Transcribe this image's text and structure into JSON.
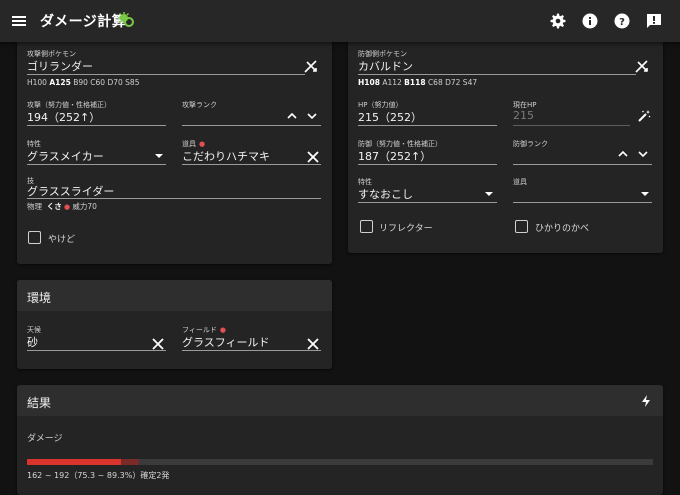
{
  "appbar": {
    "title": "ダメージ計算",
    "icons": [
      "menu-icon",
      "logo-icon",
      "settings-icon",
      "info-icon",
      "help-icon",
      "feedback-icon"
    ]
  },
  "attacker": {
    "pokemon_label": "攻撃側ポケモン",
    "pokemon_value": "ゴリランダー",
    "stats": {
      "h": "H100",
      "a": "A125",
      "rest": "B90 C60 D70 S85"
    },
    "attack_label": "攻撃（努力値・性格補正）",
    "attack_value": "194（252↑）",
    "rank_label": "攻撃ランク",
    "rank_value": "",
    "ability_label": "特性",
    "ability_value": "グラスメイカー",
    "item_label": "道具",
    "item_value": "こだわりハチマキ",
    "move_label": "技",
    "move_value": "グラススライダー",
    "move_category": "物理",
    "move_type": "くさ",
    "move_power": "威力70",
    "burn_label": "やけど"
  },
  "defender": {
    "pokemon_label": "防御側ポケモン",
    "pokemon_value": "カバルドン",
    "stats": {
      "h": "H108",
      "a": "A112",
      "b": "B118",
      "rest": "C68 D72 S47"
    },
    "hp_label": "HP（努力値）",
    "hp_value": "215（252）",
    "current_hp_label": "現在HP",
    "current_hp_value": "215",
    "defense_label": "防御（努力値・性格補正）",
    "defense_value": "187（252↑）",
    "defense_rank_label": "防御ランク",
    "defense_rank_value": "",
    "ability_label": "特性",
    "ability_value": "すなおこし",
    "item_label": "道具",
    "item_value": "",
    "reflect_label": "リフレクター",
    "light_screen_label": "ひかりのかべ"
  },
  "environment": {
    "title": "環境",
    "weather_label": "天候",
    "weather_value": "砂",
    "field_label": "フィールド",
    "field_value": "グラスフィールド"
  },
  "result": {
    "title": "結果",
    "damage_label": "ダメージ",
    "damage_text": "162 ~ 192（75.3 ~ 89.3%）確定2発",
    "min_percent": 75.3,
    "max_percent": 89.3,
    "colors": {
      "min": "#d9342b",
      "max": "#7a2a27",
      "track": "#3b3b3b"
    }
  }
}
